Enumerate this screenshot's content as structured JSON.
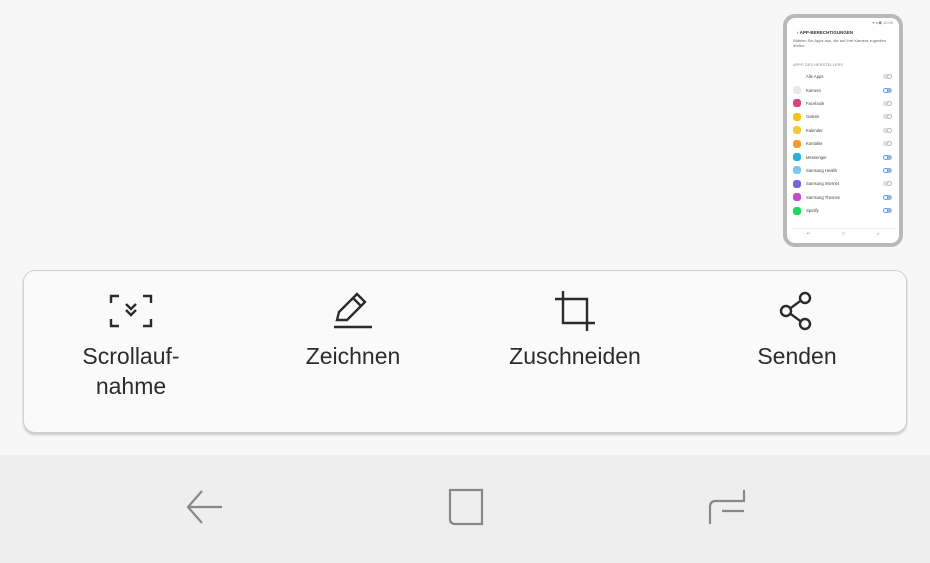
{
  "thumbnail": {
    "status": "▾ ◂ ◼ 12:00",
    "title": "APP-BERECHTIGUNGEN",
    "description": "Wählen Sie Apps aus, die auf Ihre Kamera zugreifen dürfen.",
    "section": "APPS DES HERSTELLERS",
    "rows": [
      {
        "label": "Alle Apps",
        "color": "#ffffff",
        "on": false
      },
      {
        "label": "Kamera",
        "color": "#e8e8e8",
        "on": true
      },
      {
        "label": "Facebook",
        "color": "#d9427c",
        "on": false
      },
      {
        "label": "Galerie",
        "color": "#f5c21b",
        "on": false
      },
      {
        "label": "Kalender",
        "color": "#f3cb3a",
        "on": false
      },
      {
        "label": "Kontakte",
        "color": "#f59b2d",
        "on": false
      },
      {
        "label": "Messenger",
        "color": "#27b3d8",
        "on": true
      },
      {
        "label": "Samsung Health",
        "color": "#7ac9e8",
        "on": true
      },
      {
        "label": "Samsung Internet",
        "color": "#7b61d8",
        "on": false
      },
      {
        "label": "Samsung Themes",
        "color": "#c24cc7",
        "on": true
      },
      {
        "label": "Spotify",
        "color": "#1ed760",
        "on": true
      }
    ],
    "nav": [
      "↵",
      "□",
      "⤶"
    ]
  },
  "actions": [
    {
      "label": "Scrollauf-\nnahme",
      "icon": "scroll-capture-icon"
    },
    {
      "label": "Zeichnen",
      "icon": "pen-icon"
    },
    {
      "label": "Zuschneiden",
      "icon": "crop-icon"
    },
    {
      "label": "Senden",
      "icon": "share-icon"
    }
  ],
  "navbar": {
    "back": "back-icon",
    "home": "home-icon",
    "recents": "recents-icon"
  },
  "colors": {
    "background": "#f7f7f7",
    "card": "#fafafa",
    "navbar": "#eeeeee",
    "icon": "#2b2b2b",
    "nav_icon": "#888888"
  }
}
